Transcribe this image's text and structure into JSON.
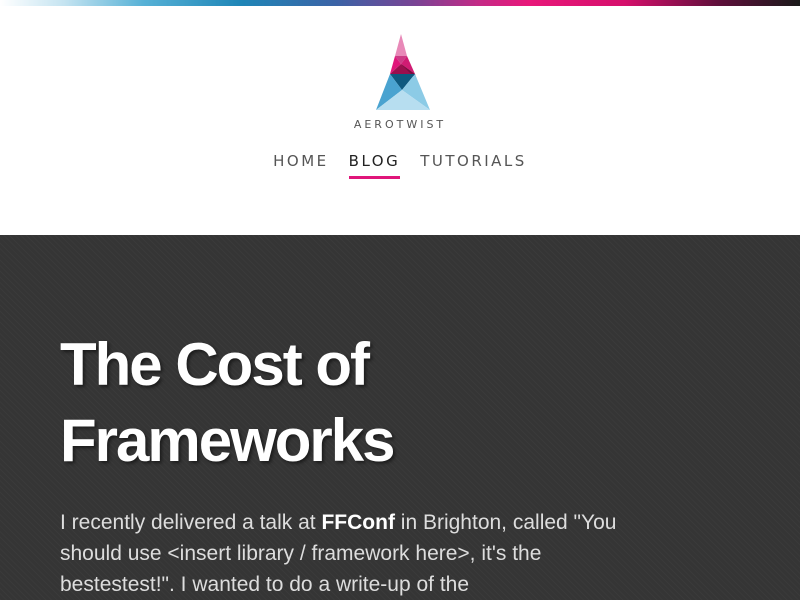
{
  "header": {
    "brand": "AEROTWIST",
    "nav": [
      {
        "label": "HOME",
        "active": false
      },
      {
        "label": "BLOG",
        "active": true
      },
      {
        "label": "TUTORIALS",
        "active": false
      }
    ]
  },
  "article": {
    "title_line1": "The Cost of",
    "title_line2": "Frameworks",
    "intro_part1": "I recently delivered a talk at ",
    "intro_bold": "FFConf",
    "intro_part2": " in Brighton, called \"You should use <insert library / framework here>, it's the bestestest!\". I wanted to do a write-up of the"
  },
  "colors": {
    "accent": "#e0157a",
    "dark_background": "#353535"
  },
  "icons": {
    "logo": "aerotwist-triangle-logo"
  }
}
